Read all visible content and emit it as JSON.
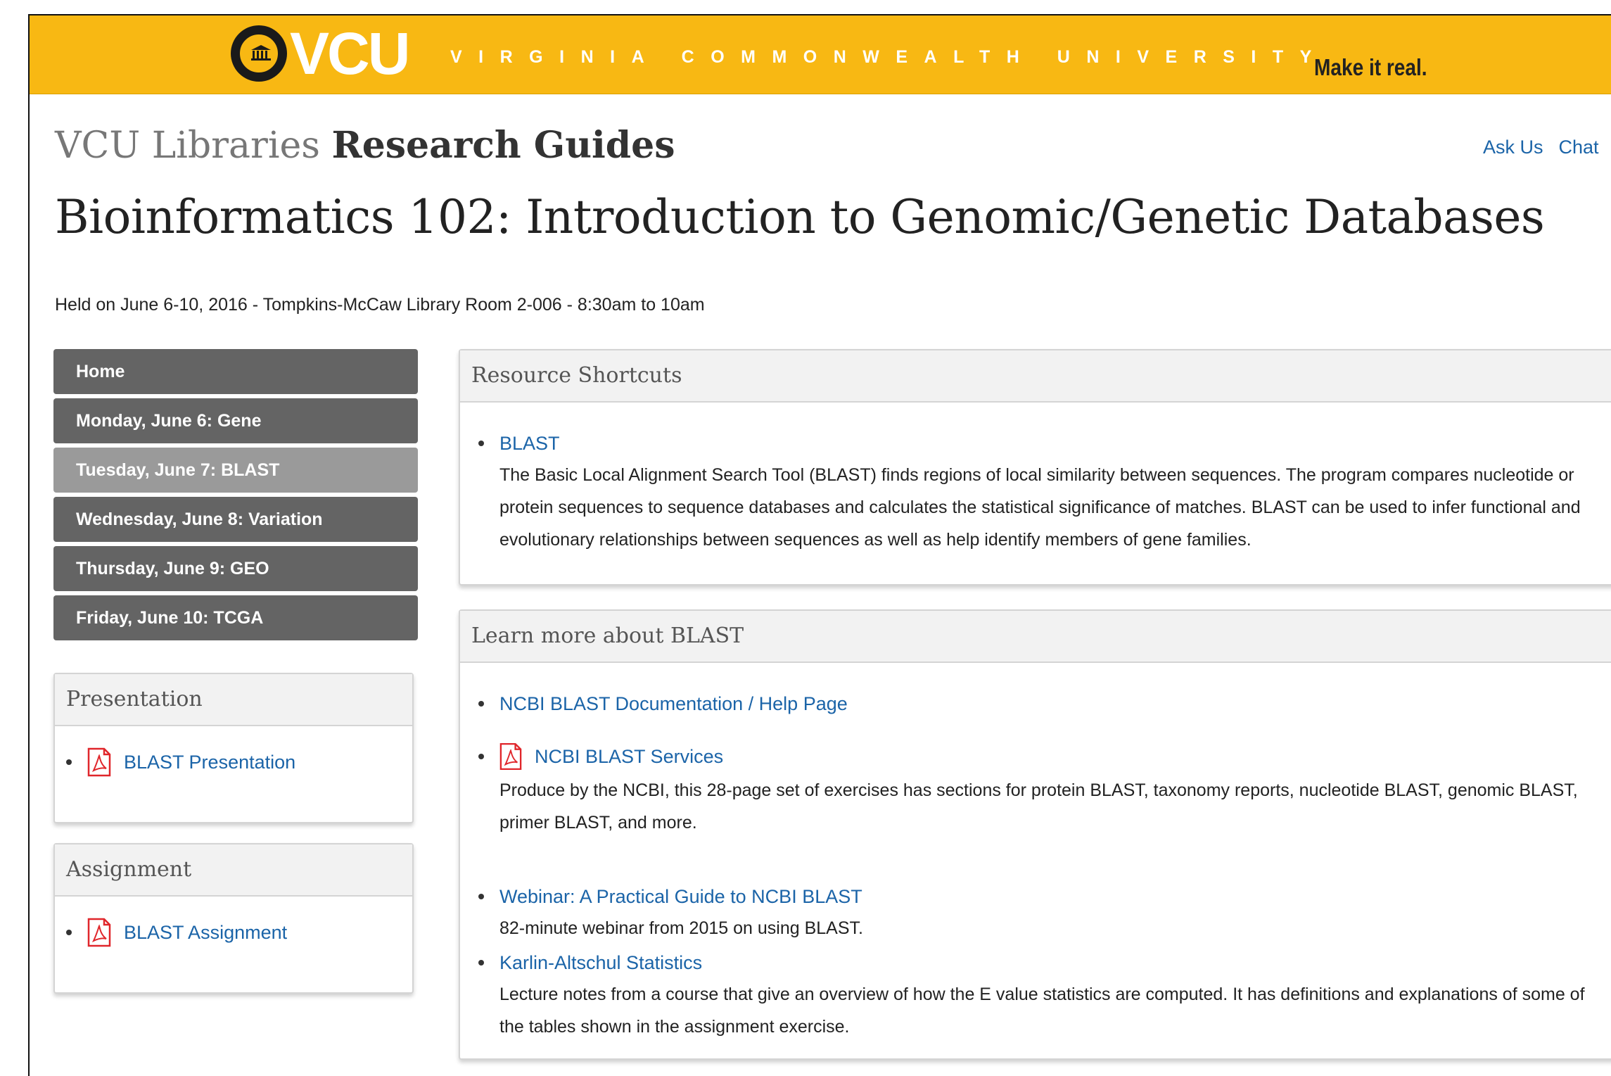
{
  "header": {
    "logo_text": "VCU",
    "university_name": "VIRGINIA COMMONWEALTH UNIVERSITY",
    "tagline": "Make it real.",
    "brand_color": "#f8b813"
  },
  "site": {
    "title_light": "VCU Libraries",
    "title_bold": "Research Guides",
    "links": {
      "ask_us": "Ask Us",
      "chat": "Chat"
    }
  },
  "guide": {
    "title": "Bioinformatics 102: Introduction to Genomic/Genetic Databases",
    "description": "Held on June 6-10, 2016 - Tompkins-McCaw Library Room 2-006 - 8:30am to 10am"
  },
  "nav": {
    "items": [
      {
        "label": "Home",
        "active": false
      },
      {
        "label": "Monday, June 6: Gene",
        "active": false
      },
      {
        "label": "Tuesday, June 7: BLAST",
        "active": true
      },
      {
        "label": "Wednesday, June 8: Variation",
        "active": false
      },
      {
        "label": "Thursday, June 9: GEO",
        "active": false
      },
      {
        "label": "Friday, June 10: TCGA",
        "active": false
      }
    ]
  },
  "presentation_box": {
    "heading": "Presentation",
    "link": {
      "label": "BLAST Presentation",
      "icon": "pdf-icon"
    }
  },
  "assignment_box": {
    "heading": "Assignment",
    "link": {
      "label": "BLAST Assignment",
      "icon": "pdf-icon"
    }
  },
  "resource_box": {
    "heading": "Resource Shortcuts",
    "items": [
      {
        "label": "BLAST",
        "description": "The Basic Local Alignment Search Tool (BLAST) finds regions of local similarity between sequences. The program compares nucleotide or protein sequences to sequence databases and calculates the statistical significance of matches. BLAST can be used to infer functional and evolutionary relationships between sequences as well as help identify members of gene families."
      }
    ]
  },
  "learn_box": {
    "heading": "Learn more about BLAST",
    "items": [
      {
        "label": "NCBI BLAST Documentation / Help Page",
        "description": ""
      },
      {
        "label": "NCBI BLAST Services",
        "icon": "pdf-icon",
        "description": "Produce by the NCBI, this 28-page set of exercises has sections for protein BLAST, taxonomy reports, nucleotide BLAST, genomic BLAST, primer BLAST, and more."
      },
      {
        "label": "Webinar: A Practical Guide to NCBI BLAST",
        "description": "82-minute webinar from 2015 on using BLAST."
      },
      {
        "label": "Karlin-Altschul Statistics",
        "description": "Lecture notes from a course that give an overview of how the E value statistics are computed. It has definitions and explanations of some of the tables shown in the assignment exercise."
      }
    ]
  }
}
